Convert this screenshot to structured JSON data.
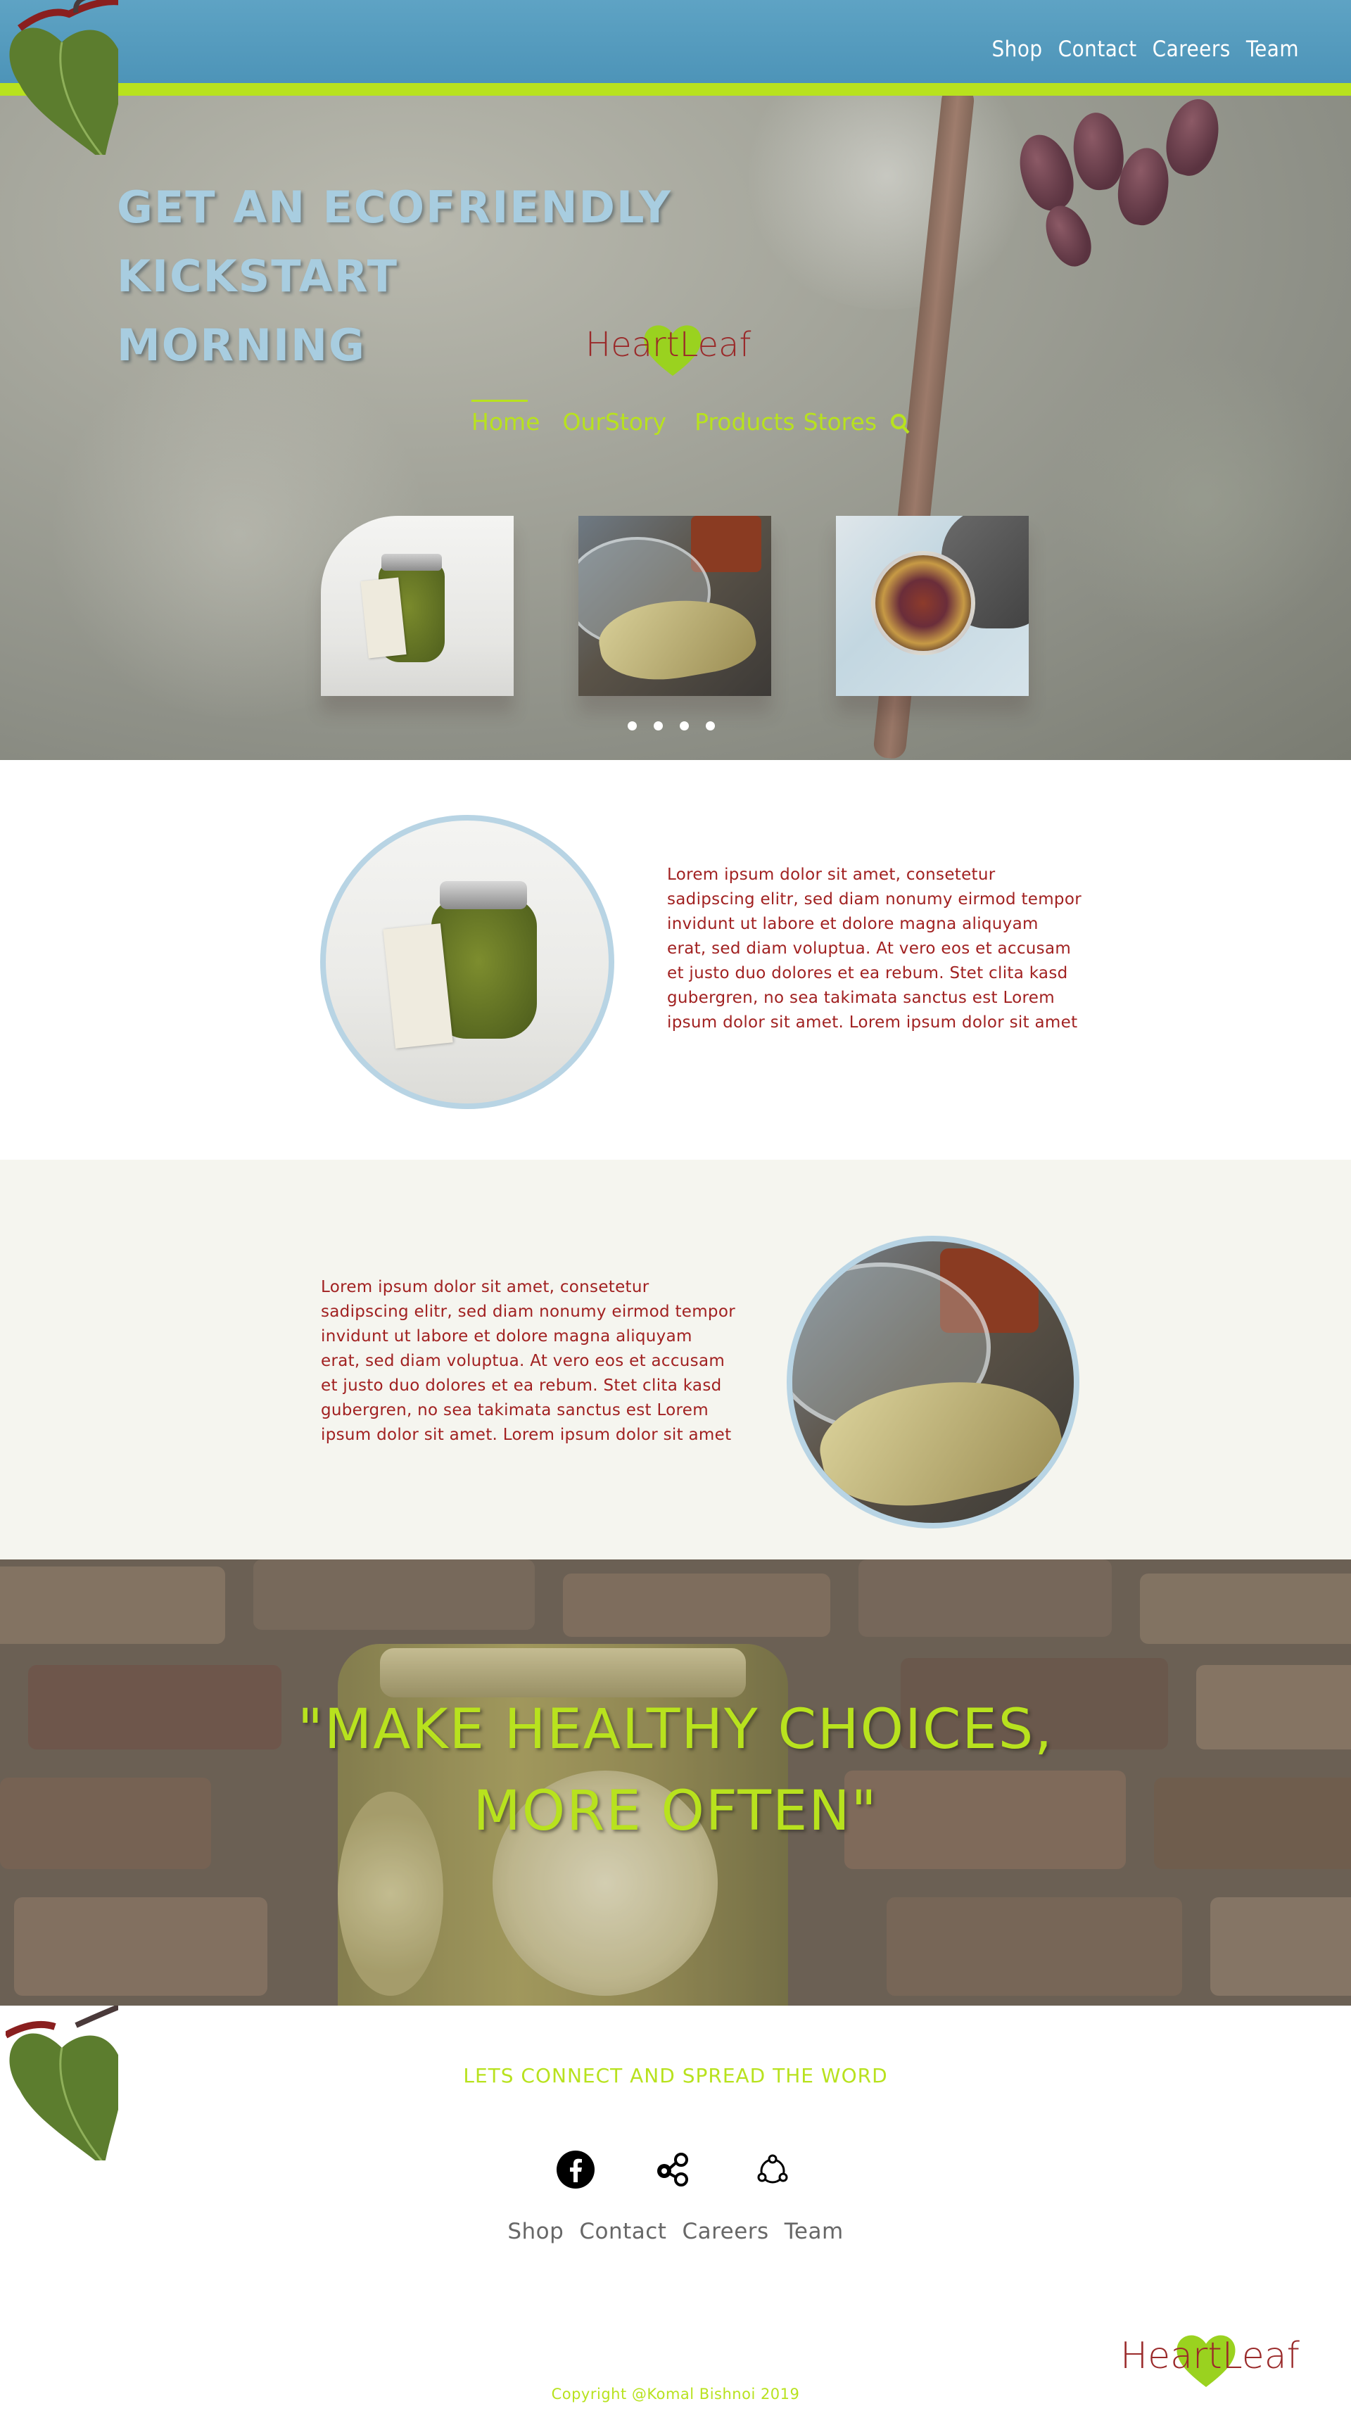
{
  "top_nav": {
    "links": [
      "Shop",
      "Contact",
      "Careers",
      "Team"
    ]
  },
  "hero": {
    "title_lines": [
      "GET AN ECOFRIENDLY",
      "KICKSTART",
      "MORNING"
    ],
    "logo": {
      "part1": "Heart",
      "part2": "Leaf"
    },
    "main_nav": [
      "Home",
      "OurStory",
      "Products",
      "Stores"
    ],
    "search_icon": "search-icon",
    "slides": [
      {
        "image": "pesto-jar-with-tag"
      },
      {
        "image": "jar-with-bay-leaves-and-spices"
      },
      {
        "image": "jar-with-dried-flowers"
      }
    ],
    "dots_count": 4
  },
  "section1": {
    "image": "pesto-jar-with-tag",
    "text": "Lorem ipsum dolor sit amet, consetetur sadipscing elitr, sed diam nonumy eirmod tempor invidunt ut labore et dolore magna aliquyam erat, sed diam voluptua. At vero eos et accusam et justo duo dolores et ea rebum. Stet clita kasd gubergren, no sea takimata sanctus est Lorem ipsum dolor sit amet. Lorem ipsum dolor sit amet"
  },
  "section2": {
    "image": "jar-with-bay-leaves",
    "text": "Lorem ipsum dolor sit amet, consetetur sadipscing elitr, sed diam nonumy eirmod tempor invidunt ut labore et dolore magna aliquyam erat, sed diam voluptua. At vero eos et accusam et justo duo dolores et ea rebum. Stet clita kasd gubergren, no sea takimata sanctus est Lorem ipsum dolor sit amet. Lorem ipsum dolor sit amet"
  },
  "quote": {
    "line1": "\"MAKE HEALTHY CHOICES,",
    "line2": "MORE OFTEN\""
  },
  "footer": {
    "connect_title": "LETS CONNECT AND SPREAD THE WORD",
    "social_icons": [
      "facebook-icon",
      "share-nodes-icon",
      "connect-circle-icon"
    ],
    "links": [
      "Shop",
      "Contact",
      "Careers",
      "Team"
    ],
    "logo": {
      "part1": "Heart",
      "part2": "Leaf"
    },
    "copyright": "Copyright @Komal Bishnoi 2019"
  },
  "colors": {
    "topbar_blue": "#5ea3c4",
    "accent_green": "#b8e21e",
    "brand_red": "#a12121",
    "title_blue": "#a8cde0",
    "circle_border": "#b8d4e4",
    "section2_bg": "#f5f5ef"
  }
}
